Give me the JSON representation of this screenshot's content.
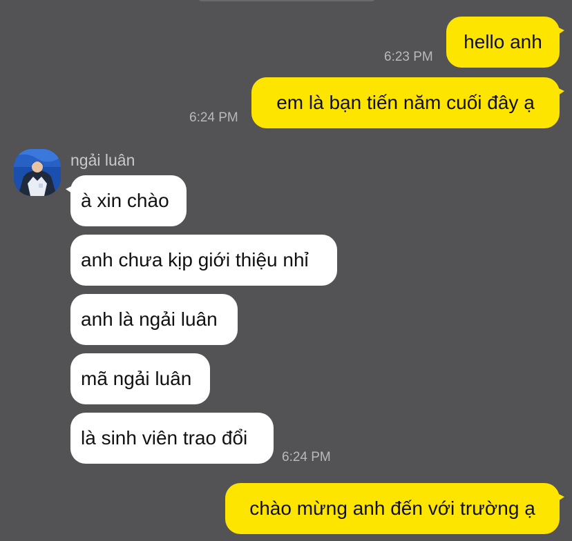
{
  "chat": {
    "messages": [
      {
        "text": "hello anh",
        "time": "6:23 PM",
        "direction": "outgoing"
      },
      {
        "text": "em là bạn tiến năm cuối đây ạ",
        "time": "6:24 PM",
        "direction": "outgoing"
      },
      {
        "text": "à xin chào",
        "direction": "incoming"
      },
      {
        "text": "anh chưa kịp giới thiệu nhỉ",
        "direction": "incoming"
      },
      {
        "text": "anh là ngải luân",
        "direction": "incoming"
      },
      {
        "text": "mã ngải luân",
        "direction": "incoming"
      },
      {
        "text": "là sinh viên trao đổi",
        "time": "6:24 PM",
        "direction": "incoming"
      },
      {
        "text": "chào mừng anh đến với trường ạ",
        "direction": "outgoing"
      }
    ],
    "sender": {
      "name": "ngải luân",
      "avatar_icon": "profile-photo"
    }
  },
  "colors": {
    "background": "#535254",
    "outgoing_bubble": "#fee500",
    "incoming_bubble": "#ffffff",
    "timestamp": "#b9b8ba"
  }
}
